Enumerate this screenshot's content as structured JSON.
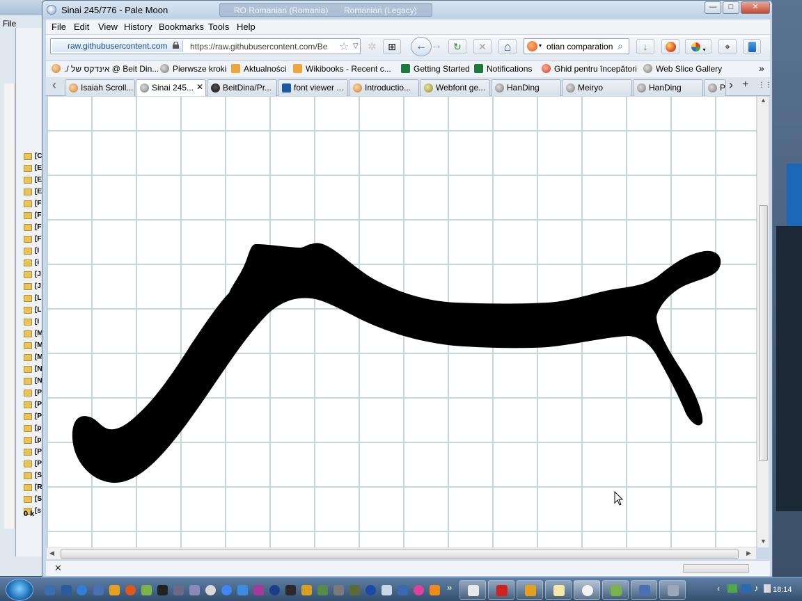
{
  "window": {
    "title": "Sinai 245/776 - Pale Moon",
    "ghost_tab_1": "RO Romanian (Romania)",
    "ghost_tab_2": "Romanian (Legacy)",
    "minimize": "—",
    "maximize": "□",
    "close": "✕"
  },
  "menu": {
    "file": "File",
    "edit": "Edit",
    "view": "View",
    "history": "History",
    "bookmarks": "Bookmarks",
    "tools": "Tools",
    "help": "Help"
  },
  "nav": {
    "site_identity": "raw.githubusercontent.com",
    "url": "https://raw.githubusercontent.com/Be",
    "search_text": "otian comparation",
    "back_icon": "←",
    "forward_icon": "→",
    "reload_icon": "↻",
    "stop_icon": "✕",
    "home_icon": "⌂",
    "download_icon": "↓"
  },
  "bookmarks": [
    "./ אינדקס של @ Beit Din...",
    "Pierwsze kroki",
    "Aktualności",
    "Wikibooks - Recent c...",
    "Getting Started",
    "Notifications",
    "Ghid pentru începători",
    "Web Slice Gallery"
  ],
  "bookmarks_overflow": "»",
  "tabs": [
    "Isaiah Scroll...",
    "Sinai 245...",
    "BeitDina/Pr...",
    "font viewer ...",
    "Introductio...",
    "Webfont ge...",
    "HanDing",
    "Meiryo",
    "HanDing",
    "P"
  ],
  "tab_controls": {
    "scroll_left": "‹",
    "scroll_right": "›",
    "new_tab": "+",
    "list_all": "⋮⋮"
  },
  "status": {
    "close_icon": "✕"
  },
  "background_window": {
    "file_menu": "File",
    "folder_labels": [
      "[C",
      "[E",
      "[E",
      "[E",
      "[F",
      "[F",
      "[F",
      "[F",
      "[I",
      "[i",
      "[J",
      "[J",
      "[L",
      "[L",
      "[I",
      "[M",
      "[M",
      "[M",
      "[N",
      "[N",
      "[P",
      "[P",
      "[P",
      "[p",
      "[p",
      "[P",
      "[P",
      "[S",
      "[R",
      "[S",
      "[s"
    ],
    "footer": "0 k"
  },
  "taskbar": {
    "clock": "18:14"
  },
  "colors": {
    "grid_line": "#bfd9de",
    "glyph_fill": "#000000",
    "title_bar": "#c9d9ea"
  }
}
